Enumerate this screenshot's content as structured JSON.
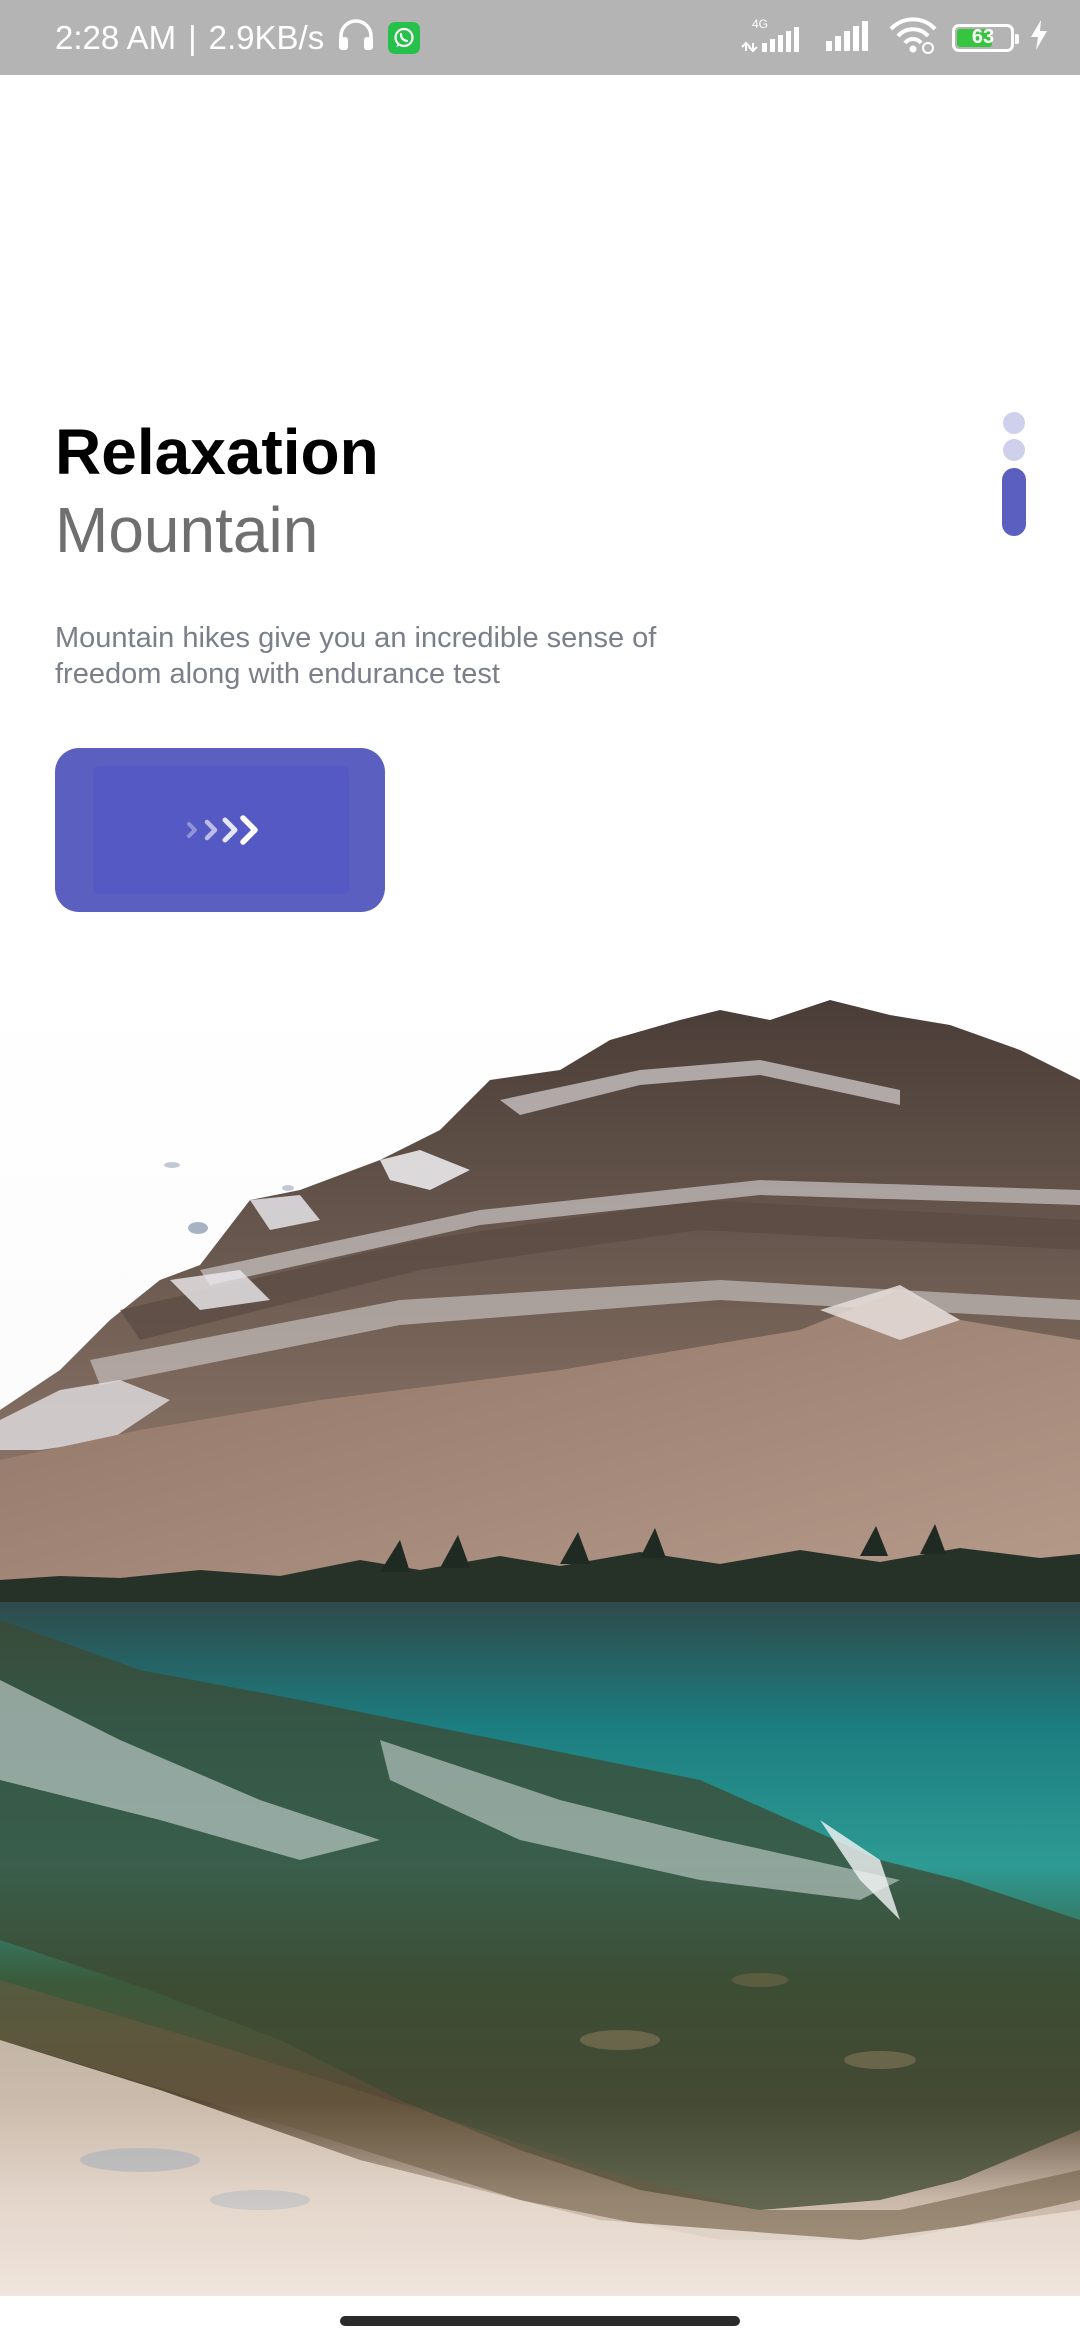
{
  "status_bar": {
    "time": "2:28 AM",
    "separator": "|",
    "speed": "2.9KB/s",
    "network_type": "4G",
    "battery_level": "63",
    "icons": [
      "headphones-icon",
      "whatsapp-icon",
      "signal-4g-icon",
      "signal-icon",
      "wifi-icon",
      "battery-icon",
      "charging-icon"
    ]
  },
  "onboarding": {
    "title": "Relaxation",
    "subtitle": "Mountain",
    "description": "Mountain hikes give you an incredible sense of freedom along with endurance test",
    "next_button_icon": "chevrons-right-icon",
    "page_indicator": {
      "total": 3,
      "active_index": 2
    }
  },
  "colors": {
    "accent": "#5a5fc0",
    "indicator_inactive": "#cfd1ec",
    "title": "#000000",
    "subtitle": "#6f6f6f",
    "description": "#7a7f8a",
    "status_bar": "#b4b4b4"
  },
  "scenery": {
    "subject": "snowy-mountain-lake-reflection"
  }
}
